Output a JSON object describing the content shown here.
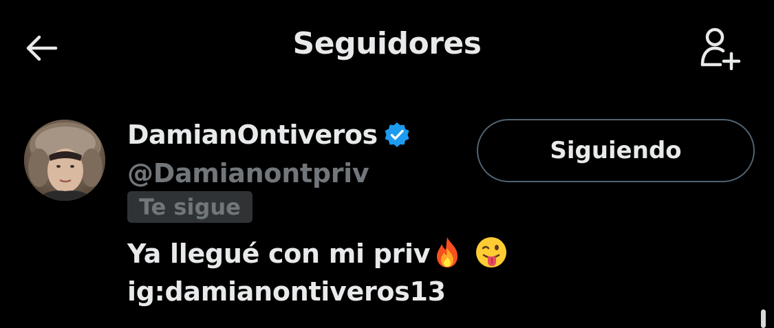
{
  "header": {
    "title": "Seguidores",
    "back_icon": "arrow-left-icon",
    "add_icon": "add-person-icon"
  },
  "user": {
    "display_name": "DamianOntiveros",
    "handle": "@Damianontpriv",
    "verified": true,
    "follows_you_label": "Te sigue",
    "bio_line1_text": "Ya llegué con mi priv",
    "bio_emojis": [
      "fire-emoji",
      "tongue-out-emoji"
    ],
    "bio_line2": "ig:damianontiveros13",
    "follow_button_label": "Siguiendo"
  },
  "colors": {
    "background": "#000000",
    "primary_text": "#e7e9ea",
    "secondary_text": "#71767b",
    "badge_bg": "#2f3336",
    "button_border": "#536471",
    "verified_blue": "#1d9bf0"
  }
}
